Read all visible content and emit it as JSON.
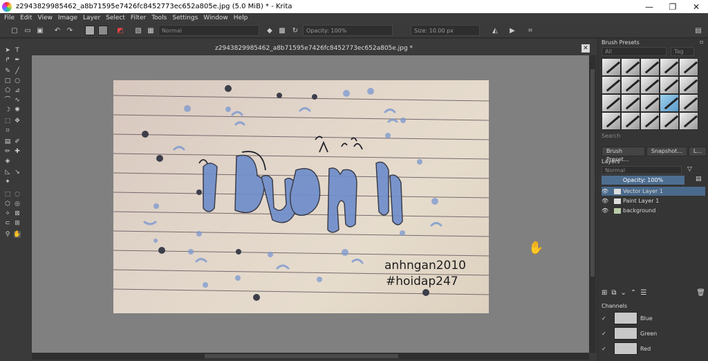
{
  "window": {
    "title": "z2943829985462_a8b71595e7426fc8452773ec652a805e.jpg (5.0 MiB)  * - Krita",
    "minimize": "—",
    "maximize": "❐",
    "close": "✕"
  },
  "menu": [
    "File",
    "Edit",
    "View",
    "Image",
    "Layer",
    "Select",
    "Filter",
    "Tools",
    "Settings",
    "Window",
    "Help"
  ],
  "toolbar": {
    "blend_mode": "Normal",
    "opacity": "Opacity: 100%",
    "size": "Size: 10.00 px"
  },
  "document": {
    "tab_title": "z2943829985462_a8b71595e7426fc8452773ec652a805e.jpg *",
    "close": "✕"
  },
  "artwork": {
    "watermark_line1": "anhngan2010",
    "watermark_line2": "#hoidap247"
  },
  "brush_presets": {
    "title": "Brush Presets",
    "filter": "All",
    "tag": "Tag",
    "search_placeholder": "Search"
  },
  "dock_tabs": [
    "Brush Preset...",
    "Snapshot...",
    "L..."
  ],
  "layers": {
    "title": "Layers",
    "blend_mode": "Normal",
    "opacity": "Opacity:  100%",
    "items": [
      {
        "name": "Vector Layer 1",
        "selected": true
      },
      {
        "name": "Paint Layer 1",
        "selected": false
      },
      {
        "name": "background",
        "selected": false
      }
    ]
  },
  "channels": {
    "title": "Channels",
    "items": [
      "Blue",
      "Green",
      "Red"
    ]
  },
  "colors": {
    "accent": "#4a6a8c",
    "paper": "#e2d6ca",
    "ink_blue": "#6d8ccb"
  }
}
